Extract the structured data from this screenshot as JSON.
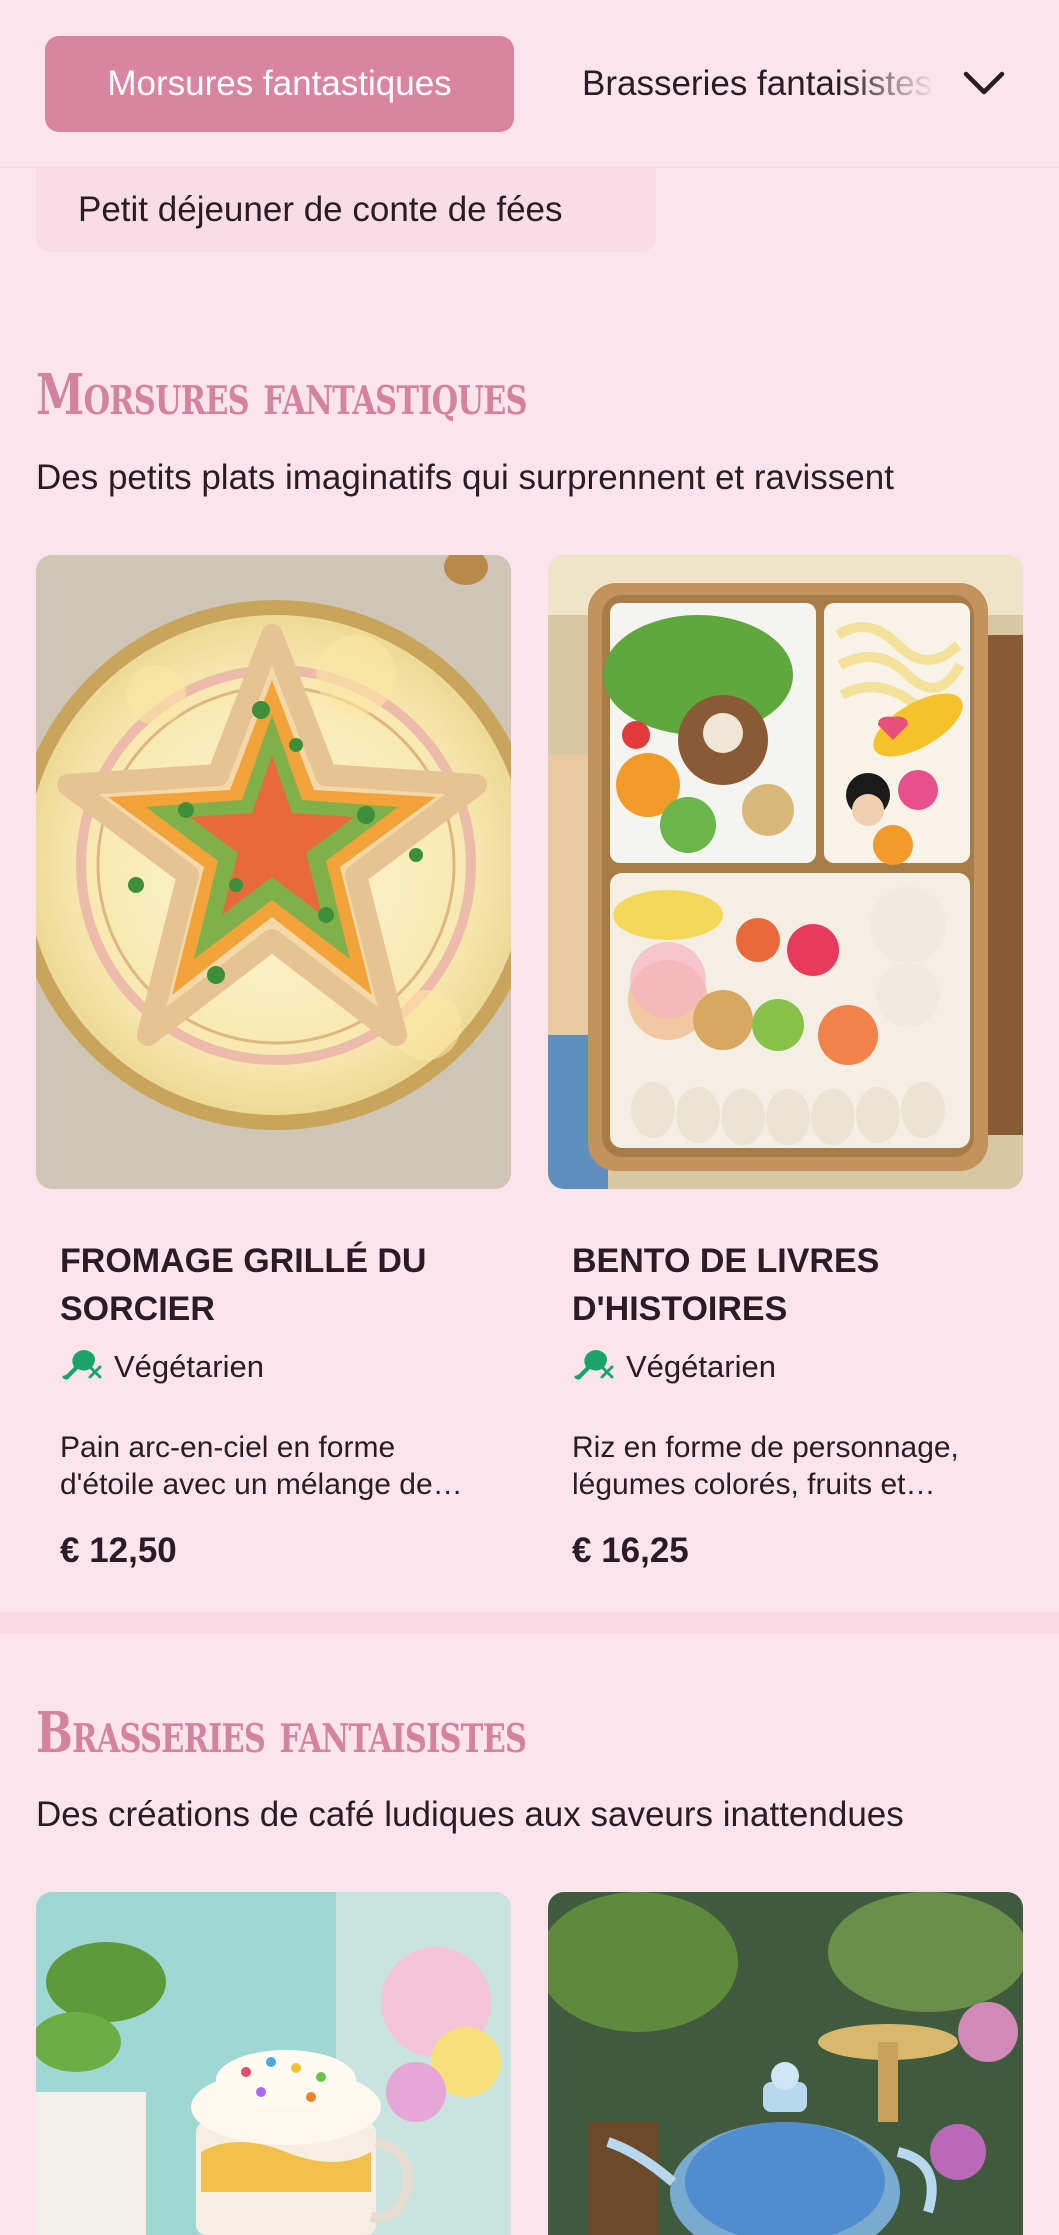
{
  "nav": {
    "active_tab": "Morsures fantastiques",
    "next_tab": "Brasseries fantaisistes",
    "second_row_tab": "Petit déjeuner de conte de fées",
    "chevron_icon": "chevron-down-icon"
  },
  "sections": [
    {
      "title": "Morsures fantastiques",
      "subtitle": "Des petits plats imaginatifs qui surprennent et ravissent",
      "items": [
        {
          "name": "Fromage grillé du sorcier",
          "diet": "Végétarien",
          "diet_icon": "vegetarian-drumstick-icon",
          "description": "Pain arc-en-ciel en forme d'étoile avec un mélange de légumes colorés",
          "price": "€ 12,50",
          "image_icon": "star-sandwich-photo"
        },
        {
          "name": "Bento de livres d'histoires",
          "diet": "Végétarien",
          "diet_icon": "vegetarian-drumstick-icon",
          "description": "Riz en forme de personnage, légumes colorés, fruits et garnitures",
          "price": "€ 16,25",
          "image_icon": "character-bento-photo"
        }
      ]
    },
    {
      "title": "Brasseries fantaisistes",
      "subtitle": "Des créations de café ludiques aux saveurs inattendues",
      "items": [
        {
          "image_icon": "whipped-latte-photo"
        },
        {
          "image_icon": "fairy-teapot-photo"
        }
      ]
    }
  ],
  "colors": {
    "background": "#fce4ec",
    "accent": "#d9859f",
    "title_pink": "#d382a0",
    "vegetarian_green": "#1aa36a"
  }
}
